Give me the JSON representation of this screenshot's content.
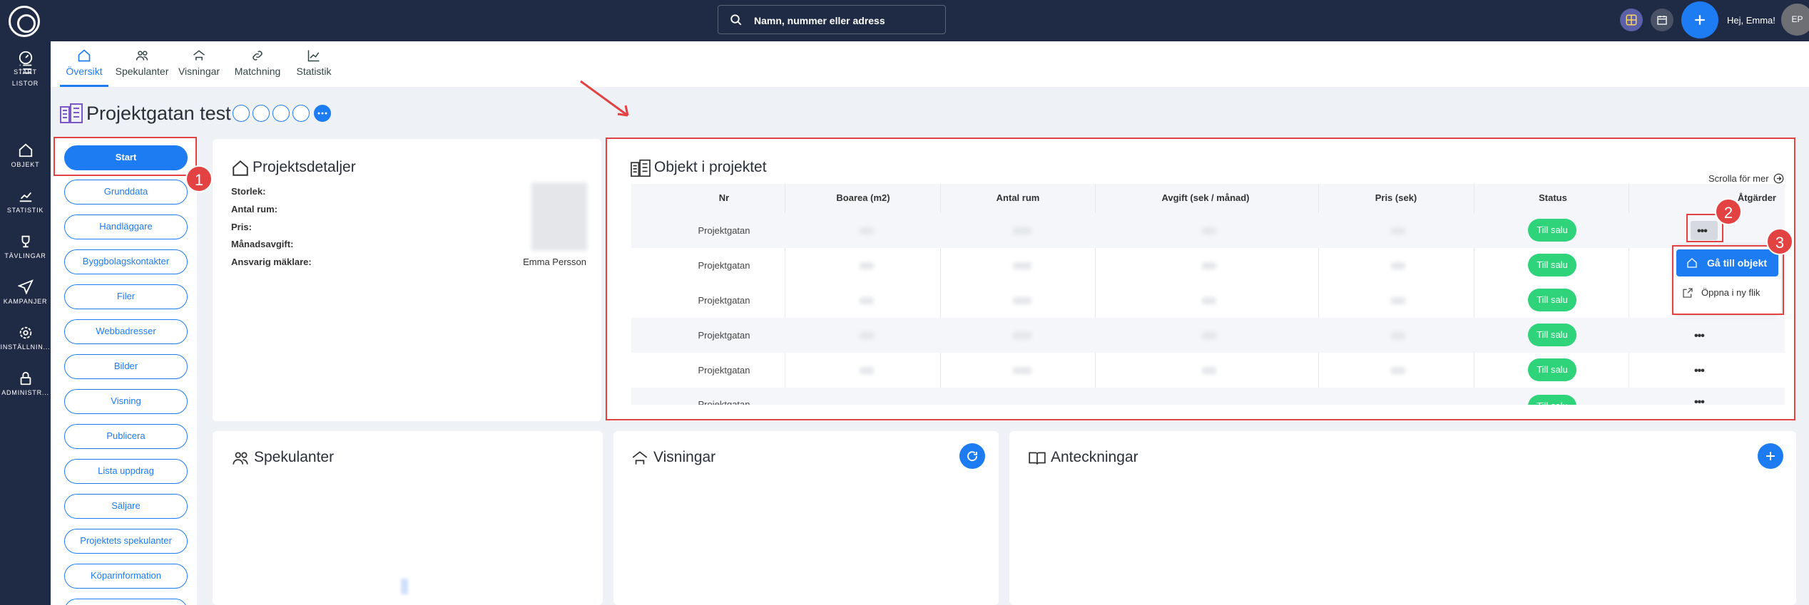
{
  "sidebar": {
    "items": [
      {
        "label": "START",
        "icon": "dashboard-icon"
      },
      {
        "label": "LISTOR",
        "icon": "list-icon"
      },
      {
        "label": "OBJEKT",
        "icon": "home-icon"
      },
      {
        "label": "STATISTIK",
        "icon": "chart-icon"
      },
      {
        "label": "TÄVLINGAR",
        "icon": "trophy-icon"
      },
      {
        "label": "KAMPANJER",
        "icon": "send-icon"
      },
      {
        "label": "INSTÄLLNIN...",
        "icon": "gear-icon"
      },
      {
        "label": "ADMINISTR...",
        "icon": "lock-icon"
      }
    ]
  },
  "topbar": {
    "search_placeholder": "Namn, nummer eller adress",
    "greeting": "Hej, Emma!",
    "avatar_initials": "EP"
  },
  "tabs": [
    {
      "label": "Översikt",
      "active": true
    },
    {
      "label": "Spekulanter"
    },
    {
      "label": "Visningar"
    },
    {
      "label": "Matchning"
    },
    {
      "label": "Statistik"
    }
  ],
  "page": {
    "title": "Projektgatan test"
  },
  "left_menu": [
    "Start",
    "Grunddata",
    "Handläggare",
    "Byggbolagskontakter",
    "Filer",
    "Webbadresser",
    "Bilder",
    "Visning",
    "Publicera",
    "Lista uppdrag",
    "Säljare",
    "Projektets spekulanter",
    "Köparinformation"
  ],
  "details": {
    "title": "Projektsdetaljer",
    "rows": [
      {
        "label": "Storlek:",
        "value": ""
      },
      {
        "label": "Antal rum:",
        "value": ""
      },
      {
        "label": "Pris:",
        "value": ""
      },
      {
        "label": "Månadsavgift:",
        "value": ""
      },
      {
        "label": "Ansvarig mäklare:",
        "value": "Emma Persson"
      }
    ]
  },
  "objects": {
    "title": "Objekt i projektet",
    "scroll_hint": "Scrolla för mer",
    "columns": [
      "Nr",
      "Boarea (m2)",
      "Antal rum",
      "Avgift (sek / månad)",
      "Pris (sek)",
      "Status",
      "Åtgärder"
    ],
    "rows": [
      {
        "nr": "Projektgatan",
        "status": "Till salu",
        "actions": "•••"
      },
      {
        "nr": "Projektgatan",
        "status": "Till salu",
        "actions": ""
      },
      {
        "nr": "Projektgatan",
        "status": "Till salu",
        "actions": ""
      },
      {
        "nr": "Projektgatan",
        "status": "Till salu",
        "actions": "•••"
      },
      {
        "nr": "Projektgatan",
        "status": "Till salu",
        "actions": "•••"
      },
      {
        "nr": "Projektgatan",
        "status": "Till salu",
        "actions": "•••"
      }
    ],
    "menu": {
      "go": "Gå till objekt",
      "newtab": "Öppna i ny flik"
    }
  },
  "cards": {
    "spekulanter": "Spekulanter",
    "visningar": "Visningar",
    "anteckningar": "Anteckningar"
  },
  "annotations": [
    "1",
    "2",
    "3"
  ],
  "colors": {
    "accent": "#1d7cf2",
    "nav": "#1f2a44",
    "status": "#2fd37a",
    "highlight": "#e34242"
  }
}
